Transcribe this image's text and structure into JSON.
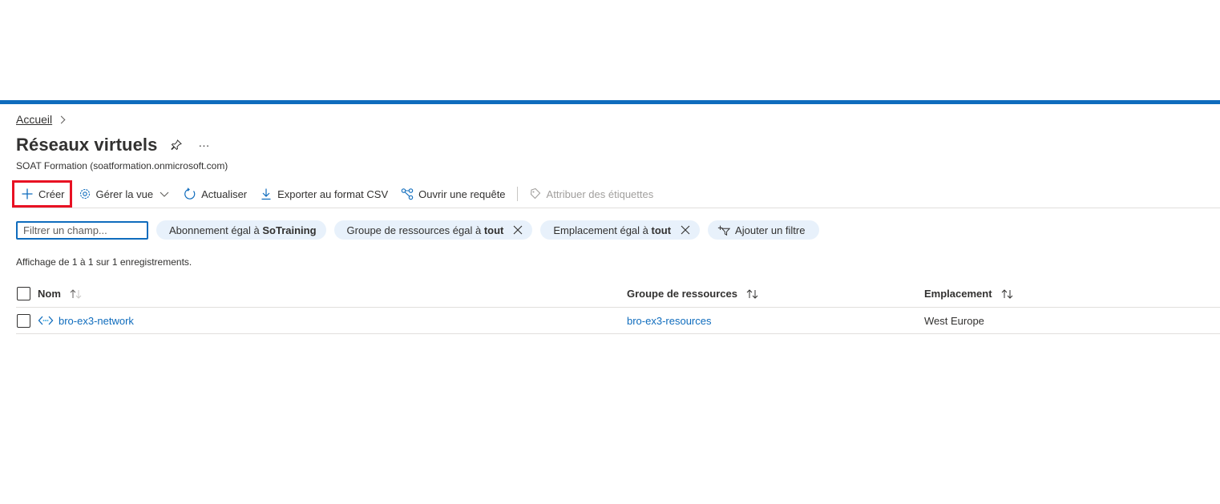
{
  "breadcrumb": {
    "home": "Accueil"
  },
  "page": {
    "title": "Réseaux virtuels",
    "subtitle": "SOAT Formation (soatformation.onmicrosoft.com)",
    "more": "···"
  },
  "toolbar": {
    "create": "Créer",
    "manage_view": "Gérer la vue",
    "refresh": "Actualiser",
    "export_csv": "Exporter au format CSV",
    "open_query": "Ouvrir une requête",
    "assign_tags": "Attribuer des étiquettes"
  },
  "filters": {
    "placeholder": "Filtrer un champ...",
    "subscription_prefix": "Abonnement égal à ",
    "subscription_value": "SoTraining",
    "resource_group_prefix": "Groupe de ressources égal à ",
    "resource_group_value": "tout",
    "location_prefix": "Emplacement égal à ",
    "location_value": "tout",
    "add_filter": "Ajouter un filtre"
  },
  "records": {
    "summary": "Affichage de 1 à 1 sur 1 enregistrements."
  },
  "table": {
    "columns": {
      "name": "Nom",
      "resource_group": "Groupe de ressources",
      "location": "Emplacement"
    },
    "rows": [
      {
        "name": "bro-ex3-network",
        "resource_group": "bro-ex3-resources",
        "location": "West Europe"
      }
    ]
  },
  "colors": {
    "accent": "#0f6cbd",
    "highlight_box": "#e81123",
    "pill_bg": "#e8f1fb"
  }
}
